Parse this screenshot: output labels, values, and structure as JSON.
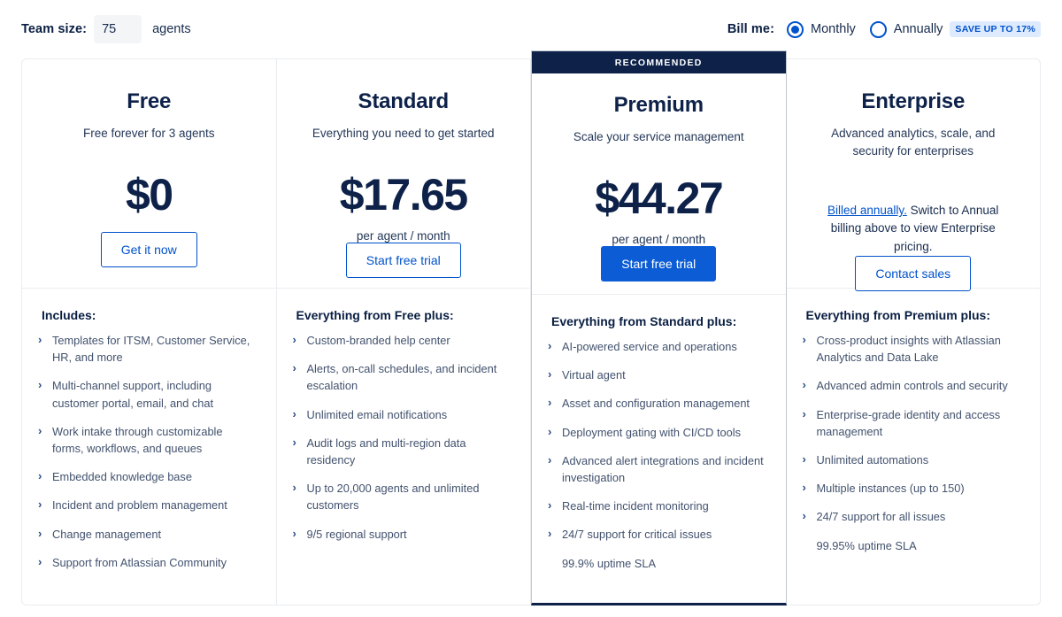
{
  "controls": {
    "team_size_label": "Team size:",
    "team_size_value": "75",
    "team_size_placeholder": "75",
    "team_size_unit": "agents",
    "billing_label": "Bill me:",
    "options": [
      {
        "label": "Monthly",
        "selected": true
      },
      {
        "label": "Annually",
        "selected": false
      }
    ],
    "save_badge": "SAVE UP TO 17%"
  },
  "plans": [
    {
      "name": "Free",
      "tagline": "Free forever for 3 agents",
      "price": "$0",
      "price_unit": "",
      "cta": "Get it now",
      "cta_style": "secondary",
      "ribbon": "",
      "features_title": "Includes:",
      "features": [
        "Templates for ITSM, Customer Service, HR, and more",
        "Multi-channel support, including customer portal, email, and chat",
        "Work intake through customizable forms, workflows, and queues",
        "Embedded knowledge base",
        "Incident and problem management",
        "Change management",
        "Support from Atlassian Community"
      ],
      "footnote": ""
    },
    {
      "name": "Standard",
      "tagline": "Everything you need to get started",
      "price": "$17.65",
      "price_unit": "per agent / month",
      "cta": "Start free trial",
      "cta_style": "secondary",
      "ribbon": "",
      "features_title": "Everything from Free plus:",
      "features": [
        "Custom-branded help center",
        "Alerts, on-call schedules, and incident escalation",
        "Unlimited email notifications",
        "Audit logs and multi-region data residency",
        "Up to 20,000 agents and unlimited customers",
        "9/5 regional support"
      ],
      "footnote": ""
    },
    {
      "name": "Premium",
      "tagline": "Scale your service management",
      "price": "$44.27",
      "price_unit": "per agent / month",
      "cta": "Start free trial",
      "cta_style": "primary",
      "ribbon": "RECOMMENDED",
      "features_title": "Everything from Standard plus:",
      "features": [
        "AI-powered service and operations",
        "Virtual agent",
        "Asset and configuration management",
        "Deployment gating with CI/CD tools",
        "Advanced alert integrations and incident investigation",
        "Real-time incident monitoring",
        "24/7 support for critical issues"
      ],
      "footnote": "99.9% uptime SLA"
    },
    {
      "name": "Enterprise",
      "tagline": "Advanced analytics, scale, and security for enterprises",
      "price": "",
      "price_unit": "",
      "note_link": "Billed annually.",
      "note_text": " Switch to Annual billing above to view Enterprise pricing.",
      "cta": "Contact sales",
      "cta_style": "secondary",
      "ribbon": "",
      "features_title": "Everything from Premium plus:",
      "features": [
        "Cross-product insights with Atlassian Analytics and Data Lake",
        "Advanced admin controls and security",
        "Enterprise-grade identity and access management",
        "Unlimited automations",
        "Multiple instances (up to 150)",
        "24/7 support for all issues"
      ],
      "footnote": "99.95% uptime SLA"
    }
  ],
  "colors": {
    "accent": "#0052cc",
    "primary_button": "#0b5cd5",
    "navy": "#0d2149",
    "badge_bg": "#deebff",
    "border": "#ebecf0"
  },
  "icons": {
    "chevron": "›"
  }
}
